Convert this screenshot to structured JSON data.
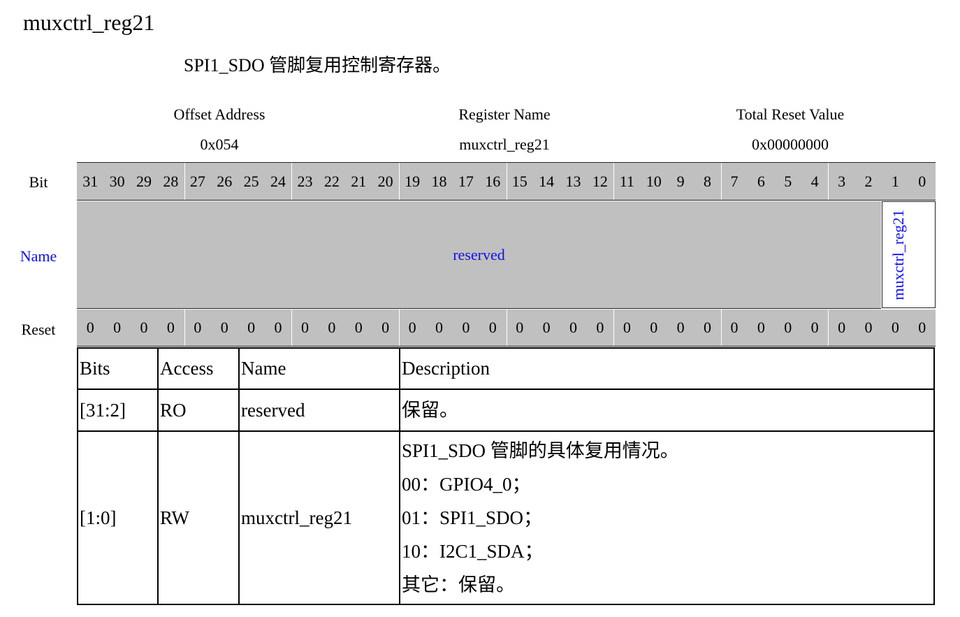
{
  "title": "muxctrl_reg21",
  "subtitle": "SPI1_SDO 管脚复用控制寄存器。",
  "header": {
    "offset_label": "Offset Address",
    "offset_value": "0x054",
    "regname_label": "Register Name",
    "regname_value": "muxctrl_reg21",
    "reset_label": "Total Reset Value",
    "reset_value": "0x00000000"
  },
  "row_labels": {
    "bit": "Bit",
    "name": "Name",
    "reset": "Reset"
  },
  "bits": [
    "31",
    "30",
    "29",
    "28",
    "27",
    "26",
    "25",
    "24",
    "23",
    "22",
    "21",
    "20",
    "19",
    "18",
    "17",
    "16",
    "15",
    "14",
    "13",
    "12",
    "11",
    "10",
    "9",
    "8",
    "7",
    "6",
    "5",
    "4",
    "3",
    "2",
    "1",
    "0"
  ],
  "reset_values": [
    "0",
    "0",
    "0",
    "0",
    "0",
    "0",
    "0",
    "0",
    "0",
    "0",
    "0",
    "0",
    "0",
    "0",
    "0",
    "0",
    "0",
    "0",
    "0",
    "0",
    "0",
    "0",
    "0",
    "0",
    "0",
    "0",
    "0",
    "0",
    "0",
    "0",
    "0",
    "0"
  ],
  "fields": {
    "reserved": "reserved",
    "muxctrl": "muxctrl_reg21"
  },
  "colors": {
    "field_name": "#1010ee",
    "shade": "#c0c0c0"
  },
  "table": {
    "headers": [
      "Bits",
      "Access",
      "Name",
      "Description"
    ],
    "rows": [
      {
        "bits": "[31:2]",
        "access": "RO",
        "name": "reserved",
        "description": [
          "保留。"
        ]
      },
      {
        "bits": "[1:0]",
        "access": "RW",
        "name": "muxctrl_reg21",
        "description": [
          "SPI1_SDO 管脚的具体复用情况。",
          "00：GPIO4_0；",
          "01：SPI1_SDO；",
          "10：I2C1_SDA；",
          "其它：保留。"
        ]
      }
    ]
  }
}
